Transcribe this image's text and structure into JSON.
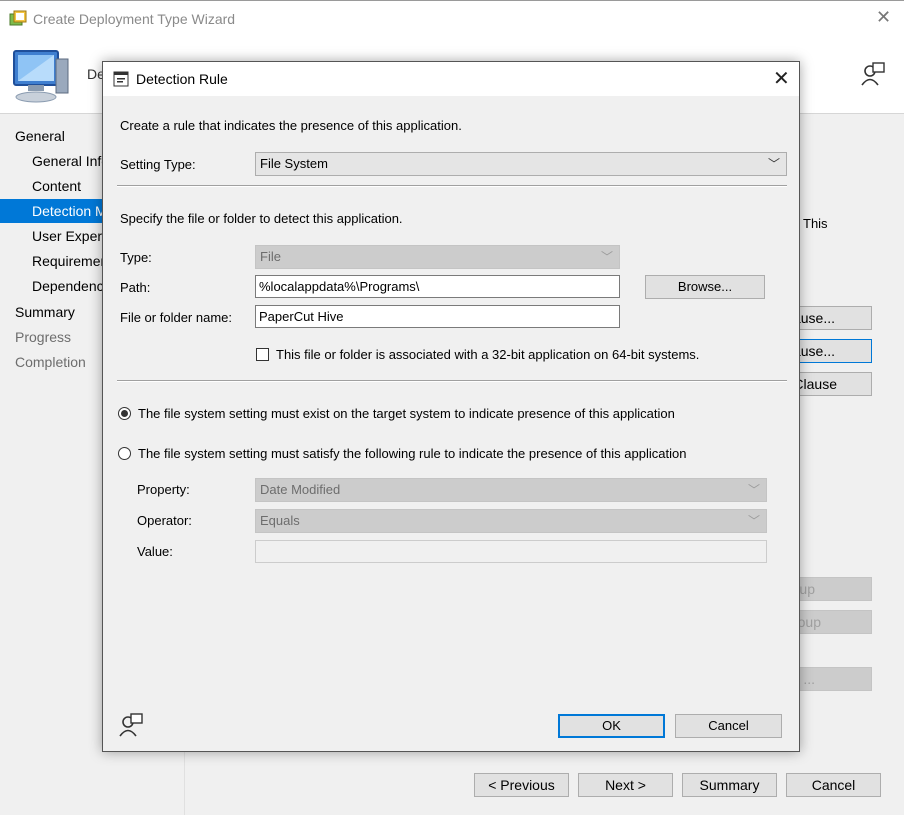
{
  "wizard": {
    "title": "Create Deployment Type Wizard",
    "header_title": "De",
    "nav": [
      {
        "label": "General",
        "level": "top"
      },
      {
        "label": "General Info",
        "level": "sub"
      },
      {
        "label": "Content",
        "level": "sub"
      },
      {
        "label": "Detection M",
        "level": "sub",
        "selected": true
      },
      {
        "label": "User Experie",
        "level": "sub"
      },
      {
        "label": "Requiremen",
        "level": "sub"
      },
      {
        "label": "Dependenci",
        "level": "sub"
      },
      {
        "label": "Summary",
        "level": "top"
      },
      {
        "label": "Progress",
        "level": "top",
        "dim": true
      },
      {
        "label": "Completion",
        "level": "top",
        "dim": true
      }
    ],
    "right_text": "This",
    "right_buttons": [
      "ause...",
      "ause...",
      "Clause",
      "up",
      "oup",
      "..."
    ],
    "footer": {
      "previous": "< Previous",
      "next": "Next >",
      "summary": "Summary",
      "cancel": "Cancel"
    }
  },
  "dialog": {
    "title": "Detection Rule",
    "intro": "Create a rule that indicates the presence of this application.",
    "setting_type_label": "Setting Type:",
    "setting_type_value": "File System",
    "specify_text": "Specify the file or folder to detect this application.",
    "type_label": "Type:",
    "type_value": "File",
    "path_label": "Path:",
    "path_value": "%localappdata%\\Programs\\",
    "browse_label": "Browse...",
    "name_label": "File or folder name:",
    "name_value": "PaperCut Hive",
    "checkbox_32bit": "This file or folder is associated with a 32-bit application on 64-bit systems.",
    "checkbox_32bit_checked": false,
    "radio_exist": "The file system setting must exist on the target system to indicate presence of this application",
    "radio_rule": "The file system setting must satisfy the following rule to indicate the presence of this application",
    "selected_radio": "exist",
    "property_label": "Property:",
    "property_value": "Date Modified",
    "operator_label": "Operator:",
    "operator_value": "Equals",
    "value_label": "Value:",
    "value_value": "",
    "ok_label": "OK",
    "cancel_label": "Cancel"
  },
  "colors": {
    "accent": "#0078d7",
    "selected_nav_bg": "#0078d7",
    "dialog_bg": "#f0f0f0"
  }
}
